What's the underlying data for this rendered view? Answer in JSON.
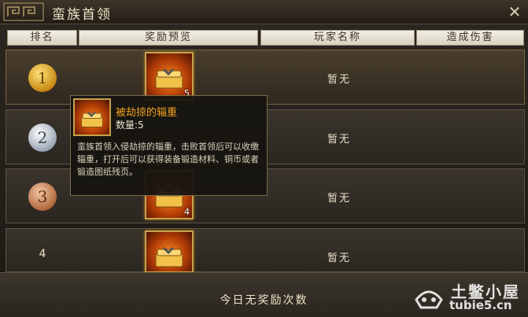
{
  "window": {
    "title": "蛮族首领",
    "close_icon": "close-icon"
  },
  "columns": [
    "排名",
    "奖励预览",
    "玩家名称",
    "造成伤害"
  ],
  "rows": [
    {
      "rank": "1",
      "medal": "gold",
      "reward_qty": "5",
      "player": "暂无"
    },
    {
      "rank": "2",
      "medal": "silver",
      "reward_qty": "",
      "player": "暂无"
    },
    {
      "rank": "3",
      "medal": "bronze",
      "reward_qty": "4",
      "player": "暂无"
    },
    {
      "rank": "4",
      "medal": "",
      "reward_qty": "",
      "player": "暂无"
    }
  ],
  "tooltip": {
    "name": "被劫掠的辎重",
    "qty": "数量:5",
    "desc": "蛮族首领入侵劫掠的辎重，击败首领后可以收缴辎重，打开后可以获得装备锻造材料、铜币或者锻造图纸残页。"
  },
  "footer": {
    "status": "今日无奖励次数"
  },
  "watermark": {
    "title": "土鳖小屋",
    "url": "tubie5.cn"
  }
}
